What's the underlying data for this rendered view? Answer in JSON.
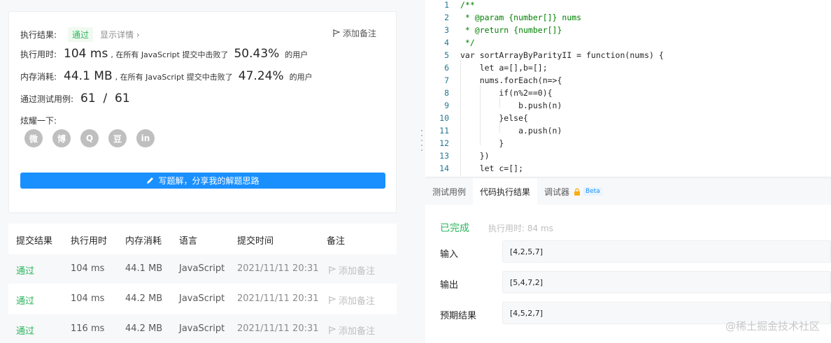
{
  "result": {
    "label": "执行结果:",
    "status": "通过",
    "detail": "显示详情 ›",
    "note": "添加备注",
    "runtime_label": "执行用时:",
    "runtime_value": "104 ms",
    "runtime_mid": ", 在所有 JavaScript 提交中击败了",
    "runtime_pct": "50.43%",
    "runtime_tail": "的用户",
    "memory_label": "内存消耗:",
    "memory_value": "44.1 MB",
    "memory_mid": ", 在所有 JavaScript 提交中击败了",
    "memory_pct": "47.24%",
    "memory_tail": "的用户",
    "tests_label": "通过测试用例:",
    "tests_value": "61  /  61",
    "share_label": "炫耀一下:",
    "share_icons": [
      "wechat-icon",
      "weibo-icon",
      "qq-icon",
      "douban-icon",
      "linkedin-icon"
    ],
    "share_glyphs": [
      "微",
      "博",
      "Q",
      "豆",
      "in"
    ],
    "write_button": "写题解，分享我的解题思路"
  },
  "submissions": {
    "headers": [
      "提交结果",
      "执行用时",
      "内存消耗",
      "语言",
      "提交时间",
      "备注"
    ],
    "rows": [
      [
        "通过",
        "104 ms",
        "44.1 MB",
        "JavaScript",
        "2021/11/11 20:31",
        "添加备注"
      ],
      [
        "通过",
        "104 ms",
        "44.2 MB",
        "JavaScript",
        "2021/11/11 20:31",
        "添加备注"
      ],
      [
        "通过",
        "116 ms",
        "44.2 MB",
        "JavaScript",
        "2021/11/11 20:31",
        "添加备注"
      ]
    ]
  },
  "editor": {
    "lines": [
      "/**",
      " * @param {number[]} nums",
      " * @return {number[]}",
      " */",
      "var sortArrayByParityII = function(nums) {",
      "    let a=[],b=[];",
      "    nums.forEach(n=>{",
      "        if(n%2==0){",
      "            b.push(n)",
      "        }else{",
      "            a.push(n)",
      "        }",
      "    })",
      "    let c=[];"
    ]
  },
  "pane": {
    "tabs": [
      "测试用例",
      "代码执行结果",
      "调试器"
    ],
    "beta": "Beta",
    "status": "已完成",
    "runtime": "执行用时: 84 ms",
    "input_label": "输入",
    "input_value": "[4,2,5,7]",
    "output_label": "输出",
    "output_value": "[5,4,7,2]",
    "expected_label": "预期结果",
    "expected_value": "[4,5,2,7]"
  },
  "watermark": "@稀土掘金技术社区",
  "colors": {
    "accent": "#1a90ff",
    "success": "#2db55d"
  }
}
